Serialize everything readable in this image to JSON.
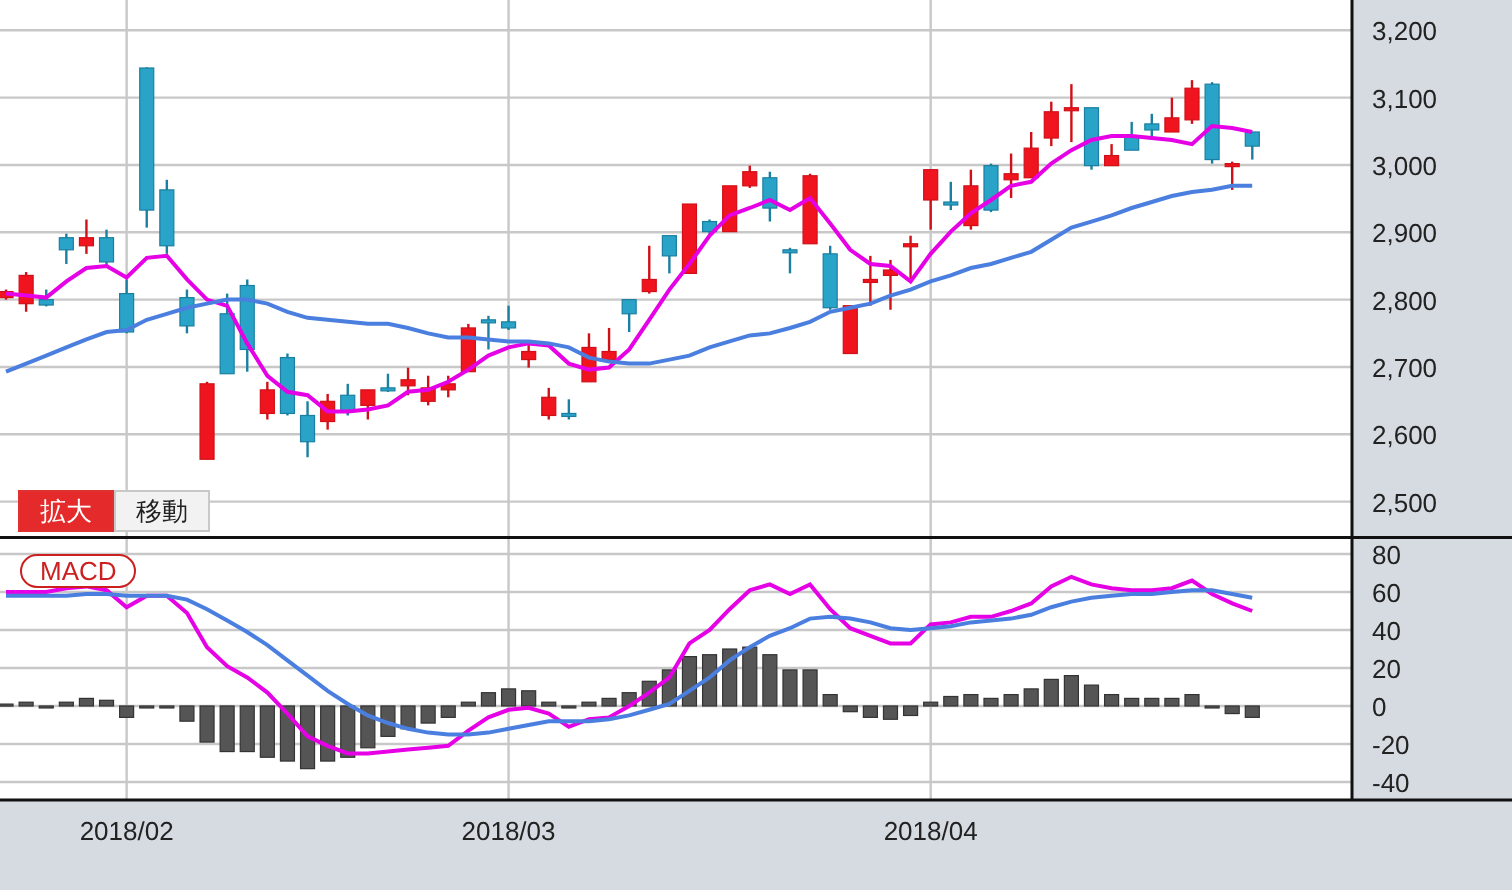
{
  "price_chart": {
    "controls": [
      {
        "label": "拡大",
        "selected": true
      },
      {
        "label": "移動",
        "selected": false
      }
    ],
    "chart_data": {
      "type": "candlestick",
      "grid": true,
      "categories": [
        null,
        null,
        null,
        null,
        null,
        null,
        null,
        null,
        null,
        null,
        null,
        null,
        null,
        null,
        null,
        null,
        null,
        null,
        null,
        null,
        null,
        null,
        null,
        null,
        null,
        null,
        null,
        null,
        null,
        null,
        null,
        null,
        null,
        null,
        null,
        null,
        null,
        null,
        null,
        null,
        null,
        null,
        null,
        null,
        null,
        null,
        null,
        null,
        null,
        null,
        null,
        null,
        null,
        null,
        null,
        null,
        null,
        null,
        null,
        null,
        null,
        null,
        null
      ],
      "ylim": [
        2449,
        3245
      ],
      "yticks": [
        {
          "value": 2500,
          "label": "2,500"
        },
        {
          "value": 2600,
          "label": "2,600"
        },
        {
          "value": 2700,
          "label": "2,700"
        },
        {
          "value": 2800,
          "label": "2,800"
        },
        {
          "value": 2900,
          "label": "2,900"
        },
        {
          "value": 3000,
          "label": "3,000"
        },
        {
          "value": 3100,
          "label": "3,100"
        },
        {
          "value": 3200,
          "label": "3,200"
        }
      ],
      "ohlc": [
        [
          2803,
          2815,
          2800,
          2812
        ],
        [
          2794,
          2841,
          2782,
          2836
        ],
        [
          2800,
          2815,
          2790,
          2792
        ],
        [
          2892,
          2898,
          2853,
          2874
        ],
        [
          2880,
          2919,
          2868,
          2892
        ],
        [
          2892,
          2904,
          2850,
          2856
        ],
        [
          2809,
          2830,
          2750,
          2752
        ],
        [
          3144,
          3145,
          2907,
          2933
        ],
        [
          2963,
          2978,
          2868,
          2880
        ],
        [
          2803,
          2815,
          2750,
          2761
        ],
        [
          2563,
          2678,
          2563,
          2675
        ],
        [
          2779,
          2809,
          2690,
          2690
        ],
        [
          2821,
          2830,
          2693,
          2726
        ],
        [
          2631,
          2678,
          2622,
          2666
        ],
        [
          2714,
          2720,
          2628,
          2631
        ],
        [
          2628,
          2649,
          2566,
          2589
        ],
        [
          2619,
          2660,
          2607,
          2649
        ],
        [
          2658,
          2675,
          2628,
          2634
        ],
        [
          2643,
          2666,
          2622,
          2666
        ],
        [
          2669,
          2690,
          2663,
          2666
        ],
        [
          2672,
          2699,
          2658,
          2681
        ],
        [
          2649,
          2687,
          2643,
          2669
        ],
        [
          2666,
          2687,
          2655,
          2675
        ],
        [
          2693,
          2764,
          2693,
          2758
        ],
        [
          2770,
          2776,
          2726,
          2767
        ],
        [
          2767,
          2791,
          2755,
          2758
        ],
        [
          2711,
          2735,
          2699,
          2723
        ],
        [
          2628,
          2669,
          2622,
          2655
        ],
        [
          2631,
          2652,
          2622,
          2628
        ],
        [
          2678,
          2750,
          2678,
          2729
        ],
        [
          2711,
          2758,
          2708,
          2723
        ],
        [
          2800,
          2800,
          2752,
          2779
        ],
        [
          2812,
          2880,
          2809,
          2830
        ],
        [
          2895,
          2895,
          2839,
          2865
        ],
        [
          2839,
          2942,
          2839,
          2942
        ],
        [
          2916,
          2919,
          2898,
          2901
        ],
        [
          2901,
          2969,
          2901,
          2969
        ],
        [
          2969,
          2999,
          2966,
          2990
        ],
        [
          2981,
          2990,
          2916,
          2936
        ],
        [
          2874,
          2877,
          2839,
          2871
        ],
        [
          2883,
          2987,
          2883,
          2984
        ],
        [
          2868,
          2880,
          2785,
          2788
        ],
        [
          2720,
          2791,
          2720,
          2791
        ],
        [
          2827,
          2865,
          2791,
          2830
        ],
        [
          2836,
          2859,
          2785,
          2844
        ],
        [
          2880,
          2895,
          2827,
          2883
        ],
        [
          2948,
          2993,
          2904,
          2993
        ],
        [
          2945,
          2975,
          2933,
          2942
        ],
        [
          2910,
          2993,
          2904,
          2969
        ],
        [
          2999,
          3002,
          2930,
          2933
        ],
        [
          2978,
          3017,
          2951,
          2987
        ],
        [
          2981,
          3049,
          2981,
          3025
        ],
        [
          3040,
          3094,
          3028,
          3079
        ],
        [
          3082,
          3120,
          3034,
          3085
        ],
        [
          3085,
          3085,
          2993,
          2999
        ],
        [
          2999,
          3031,
          2999,
          3014
        ],
        [
          3043,
          3064,
          3022,
          3022
        ],
        [
          3061,
          3076,
          3040,
          3052
        ],
        [
          3049,
          3100,
          3049,
          3070
        ],
        [
          3067,
          3126,
          3061,
          3114
        ],
        [
          3120,
          3123,
          3002,
          3008
        ],
        [
          3000,
          3005,
          2963,
          3002
        ],
        [
          3049,
          3049,
          3008,
          3028
        ]
      ],
      "series": [
        {
          "type": "line",
          "color": "#e600e6",
          "values": [
            2809,
            2806,
            2803,
            2827,
            2847,
            2850,
            2833,
            2862,
            2865,
            2830,
            2800,
            2791,
            2735,
            2687,
            2663,
            2658,
            2634,
            2634,
            2637,
            2643,
            2663,
            2666,
            2678,
            2696,
            2717,
            2729,
            2735,
            2732,
            2705,
            2696,
            2699,
            2726,
            2770,
            2815,
            2853,
            2895,
            2925,
            2936,
            2948,
            2933,
            2951,
            2913,
            2874,
            2853,
            2850,
            2827,
            2868,
            2901,
            2928,
            2948,
            2969,
            2975,
            3002,
            3022,
            3037,
            3043,
            3043,
            3040,
            3037,
            3031,
            3058,
            3055,
            3049
          ]
        },
        {
          "type": "line",
          "color": "#4a7fe0",
          "values": [
            2693,
            2705,
            2717,
            2729,
            2741,
            2752,
            2755,
            2770,
            2779,
            2788,
            2794,
            2800,
            2800,
            2794,
            2782,
            2773,
            2770,
            2767,
            2764,
            2764,
            2758,
            2750,
            2744,
            2744,
            2741,
            2738,
            2738,
            2735,
            2729,
            2714,
            2708,
            2705,
            2705,
            2711,
            2717,
            2729,
            2738,
            2747,
            2750,
            2758,
            2767,
            2782,
            2788,
            2794,
            2806,
            2815,
            2827,
            2836,
            2847,
            2853,
            2862,
            2871,
            2889,
            2907,
            2916,
            2925,
            2936,
            2945,
            2954,
            2960,
            2963,
            2969,
            2969
          ]
        }
      ]
    }
  },
  "macd_chart": {
    "chart_data": {
      "type": "bar",
      "title": "MACD",
      "grid": true,
      "categories": [
        null,
        null,
        null,
        null,
        null,
        null,
        "2018/02",
        null,
        null,
        null,
        null,
        null,
        null,
        null,
        null,
        null,
        null,
        null,
        null,
        null,
        null,
        null,
        null,
        null,
        null,
        "2018/03",
        null,
        null,
        null,
        null,
        null,
        null,
        null,
        null,
        null,
        null,
        null,
        null,
        null,
        null,
        null,
        null,
        null,
        null,
        null,
        null,
        "2018/04",
        null,
        null,
        null,
        null,
        null,
        null,
        null,
        null,
        null,
        null,
        null,
        null,
        null,
        null,
        null,
        null
      ],
      "ylim": [
        -49.5,
        89.5
      ],
      "yticks": [
        -40,
        -20,
        0,
        20,
        40,
        60,
        80
      ],
      "series": [
        {
          "color": "#555555",
          "values": [
            1,
            2,
            -1,
            2,
            4,
            3,
            -6,
            -1,
            -1,
            -8,
            -19,
            -24,
            -24,
            -27,
            -29,
            -33,
            -29,
            -27,
            -22,
            -16,
            -12,
            -9,
            -6,
            2,
            7,
            9,
            8,
            2,
            -1,
            2,
            4,
            7,
            13,
            19,
            26,
            27,
            30,
            31,
            27,
            19,
            19,
            6,
            -3,
            -6,
            -7,
            -5,
            2,
            5,
            6,
            4,
            6,
            9,
            14,
            16,
            11,
            6,
            4,
            4,
            4,
            6,
            -1,
            -4,
            -6
          ]
        },
        {
          "type": "line",
          "color": "#e600e6",
          "values": [
            60,
            60,
            60,
            62,
            63,
            61,
            52,
            58,
            58,
            49,
            31,
            21,
            15,
            7,
            -4,
            -16,
            -21,
            -25,
            -25,
            -24,
            -23,
            -22,
            -21,
            -13,
            -6,
            -2,
            -1,
            -4,
            -11,
            -7,
            -6,
            0,
            7,
            15,
            33,
            40,
            51,
            61,
            64,
            59,
            64,
            51,
            41,
            37,
            33,
            33,
            43,
            44,
            47,
            47,
            50,
            54,
            63,
            68,
            64,
            62,
            61,
            61,
            62,
            66,
            59,
            54,
            50
          ]
        },
        {
          "type": "line",
          "color": "#4a7fe0",
          "values": [
            58,
            58,
            58,
            58,
            59,
            59,
            58,
            58,
            58,
            56,
            51,
            45,
            39,
            32,
            24,
            16,
            8,
            1,
            -5,
            -9,
            -12,
            -14,
            -15,
            -15,
            -14,
            -12,
            -10,
            -8,
            -8,
            -8,
            -7,
            -5,
            -2,
            1,
            8,
            15,
            24,
            31,
            37,
            41,
            46,
            47,
            46,
            44,
            41,
            40,
            41,
            42,
            44,
            45,
            46,
            48,
            52,
            55,
            57,
            58,
            59,
            59,
            60,
            61,
            61,
            59,
            57
          ]
        }
      ]
    }
  }
}
